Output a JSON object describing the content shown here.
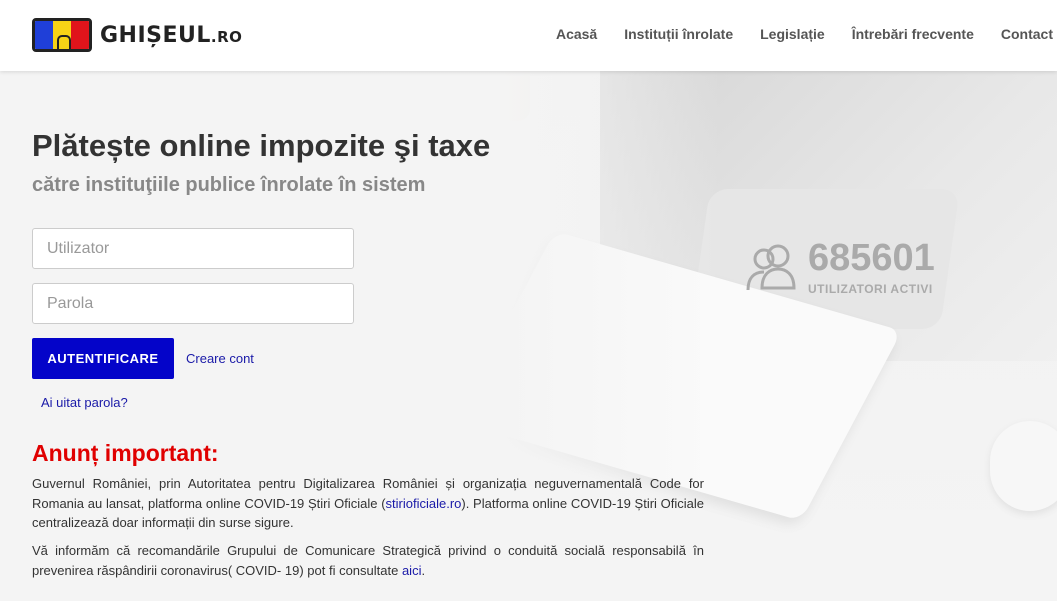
{
  "brand": {
    "logo_text": "GHIȘEUL",
    "logo_suffix": ".RO"
  },
  "nav": [
    "Acasă",
    "Instituții înrolate",
    "Legislație",
    "Întrebări frecvente",
    "Contact"
  ],
  "hero": {
    "title": "Plătește online impozite şi taxe",
    "subtitle": "către instituţiile publice înrolate în sistem"
  },
  "login": {
    "username_placeholder": "Utilizator",
    "password_placeholder": "Parola",
    "submit_label": "AUTENTIFICARE",
    "create_account": "Creare cont",
    "forgot_password": "Ai uitat parola?"
  },
  "stats": {
    "active_users": "685601",
    "active_users_label": "UTILIZATORI ACTIVI"
  },
  "notice": {
    "title": "Anunț important:",
    "p1_before": "Guvernul României, prin Autoritatea pentru Digitalizarea României și organizația neguvernamentală Code for Romania au lansat, platforma online COVID-19 Știri Oficiale (",
    "p1_link": "stirioficiale.ro",
    "p1_after": "). Platforma online COVID-19 Știri Oficiale centralizează doar informații din surse sigure.",
    "p2_before": "Vă informăm că recomandările Grupului de Comunicare Strategică privind o conduită socială responsabilă în prevenirea răspândirii coronavirus( COVID- 19) pot fi consultate ",
    "p2_link": "aici",
    "p2_after": "."
  },
  "colors": {
    "primary_button": "#0404c9",
    "notice_title": "#e00000",
    "link": "#1a1aa8"
  }
}
